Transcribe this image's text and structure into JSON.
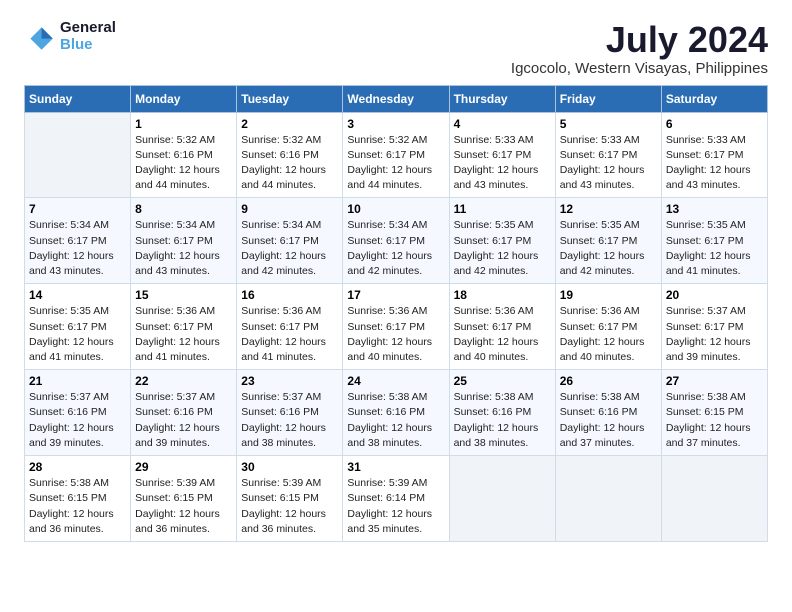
{
  "logo": {
    "line1": "General",
    "line2": "Blue"
  },
  "title": "July 2024",
  "subtitle": "Igcocolo, Western Visayas, Philippines",
  "days_of_week": [
    "Sunday",
    "Monday",
    "Tuesday",
    "Wednesday",
    "Thursday",
    "Friday",
    "Saturday"
  ],
  "weeks": [
    [
      {
        "num": "",
        "info": ""
      },
      {
        "num": "1",
        "info": "Sunrise: 5:32 AM\nSunset: 6:16 PM\nDaylight: 12 hours\nand 44 minutes."
      },
      {
        "num": "2",
        "info": "Sunrise: 5:32 AM\nSunset: 6:16 PM\nDaylight: 12 hours\nand 44 minutes."
      },
      {
        "num": "3",
        "info": "Sunrise: 5:32 AM\nSunset: 6:17 PM\nDaylight: 12 hours\nand 44 minutes."
      },
      {
        "num": "4",
        "info": "Sunrise: 5:33 AM\nSunset: 6:17 PM\nDaylight: 12 hours\nand 43 minutes."
      },
      {
        "num": "5",
        "info": "Sunrise: 5:33 AM\nSunset: 6:17 PM\nDaylight: 12 hours\nand 43 minutes."
      },
      {
        "num": "6",
        "info": "Sunrise: 5:33 AM\nSunset: 6:17 PM\nDaylight: 12 hours\nand 43 minutes."
      }
    ],
    [
      {
        "num": "7",
        "info": "Sunrise: 5:34 AM\nSunset: 6:17 PM\nDaylight: 12 hours\nand 43 minutes."
      },
      {
        "num": "8",
        "info": "Sunrise: 5:34 AM\nSunset: 6:17 PM\nDaylight: 12 hours\nand 43 minutes."
      },
      {
        "num": "9",
        "info": "Sunrise: 5:34 AM\nSunset: 6:17 PM\nDaylight: 12 hours\nand 42 minutes."
      },
      {
        "num": "10",
        "info": "Sunrise: 5:34 AM\nSunset: 6:17 PM\nDaylight: 12 hours\nand 42 minutes."
      },
      {
        "num": "11",
        "info": "Sunrise: 5:35 AM\nSunset: 6:17 PM\nDaylight: 12 hours\nand 42 minutes."
      },
      {
        "num": "12",
        "info": "Sunrise: 5:35 AM\nSunset: 6:17 PM\nDaylight: 12 hours\nand 42 minutes."
      },
      {
        "num": "13",
        "info": "Sunrise: 5:35 AM\nSunset: 6:17 PM\nDaylight: 12 hours\nand 41 minutes."
      }
    ],
    [
      {
        "num": "14",
        "info": "Sunrise: 5:35 AM\nSunset: 6:17 PM\nDaylight: 12 hours\nand 41 minutes."
      },
      {
        "num": "15",
        "info": "Sunrise: 5:36 AM\nSunset: 6:17 PM\nDaylight: 12 hours\nand 41 minutes."
      },
      {
        "num": "16",
        "info": "Sunrise: 5:36 AM\nSunset: 6:17 PM\nDaylight: 12 hours\nand 41 minutes."
      },
      {
        "num": "17",
        "info": "Sunrise: 5:36 AM\nSunset: 6:17 PM\nDaylight: 12 hours\nand 40 minutes."
      },
      {
        "num": "18",
        "info": "Sunrise: 5:36 AM\nSunset: 6:17 PM\nDaylight: 12 hours\nand 40 minutes."
      },
      {
        "num": "19",
        "info": "Sunrise: 5:36 AM\nSunset: 6:17 PM\nDaylight: 12 hours\nand 40 minutes."
      },
      {
        "num": "20",
        "info": "Sunrise: 5:37 AM\nSunset: 6:17 PM\nDaylight: 12 hours\nand 39 minutes."
      }
    ],
    [
      {
        "num": "21",
        "info": "Sunrise: 5:37 AM\nSunset: 6:16 PM\nDaylight: 12 hours\nand 39 minutes."
      },
      {
        "num": "22",
        "info": "Sunrise: 5:37 AM\nSunset: 6:16 PM\nDaylight: 12 hours\nand 39 minutes."
      },
      {
        "num": "23",
        "info": "Sunrise: 5:37 AM\nSunset: 6:16 PM\nDaylight: 12 hours\nand 38 minutes."
      },
      {
        "num": "24",
        "info": "Sunrise: 5:38 AM\nSunset: 6:16 PM\nDaylight: 12 hours\nand 38 minutes."
      },
      {
        "num": "25",
        "info": "Sunrise: 5:38 AM\nSunset: 6:16 PM\nDaylight: 12 hours\nand 38 minutes."
      },
      {
        "num": "26",
        "info": "Sunrise: 5:38 AM\nSunset: 6:16 PM\nDaylight: 12 hours\nand 37 minutes."
      },
      {
        "num": "27",
        "info": "Sunrise: 5:38 AM\nSunset: 6:15 PM\nDaylight: 12 hours\nand 37 minutes."
      }
    ],
    [
      {
        "num": "28",
        "info": "Sunrise: 5:38 AM\nSunset: 6:15 PM\nDaylight: 12 hours\nand 36 minutes."
      },
      {
        "num": "29",
        "info": "Sunrise: 5:39 AM\nSunset: 6:15 PM\nDaylight: 12 hours\nand 36 minutes."
      },
      {
        "num": "30",
        "info": "Sunrise: 5:39 AM\nSunset: 6:15 PM\nDaylight: 12 hours\nand 36 minutes."
      },
      {
        "num": "31",
        "info": "Sunrise: 5:39 AM\nSunset: 6:14 PM\nDaylight: 12 hours\nand 35 minutes."
      },
      {
        "num": "",
        "info": ""
      },
      {
        "num": "",
        "info": ""
      },
      {
        "num": "",
        "info": ""
      }
    ]
  ]
}
